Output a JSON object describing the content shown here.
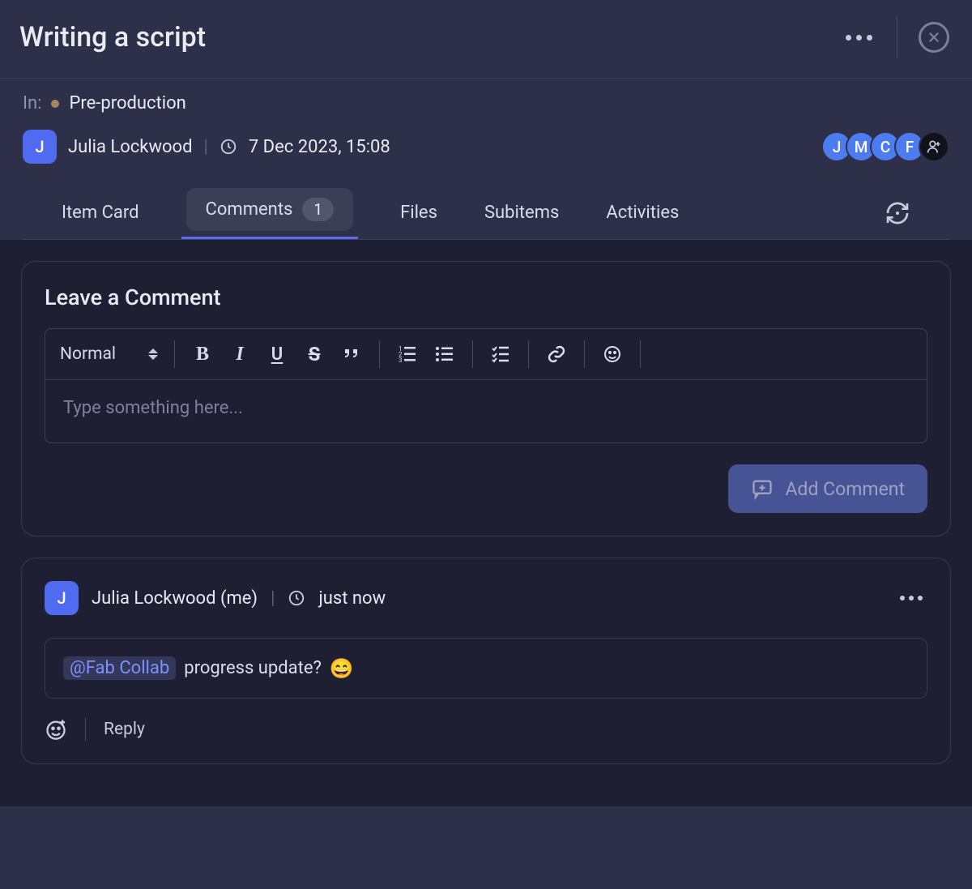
{
  "header": {
    "title": "Writing a script"
  },
  "meta": {
    "in_label": "In:",
    "in_value": "Pre-production",
    "author_initial": "J",
    "author_name": "Julia Lockwood",
    "timestamp": "7 Dec 2023, 15:08",
    "avatars": [
      "J",
      "M",
      "C",
      "F"
    ]
  },
  "tabs": {
    "item_card": "Item Card",
    "comments": "Comments",
    "comments_count": "1",
    "files": "Files",
    "subitems": "Subitems",
    "activities": "Activities"
  },
  "editor_panel": {
    "title": "Leave a Comment",
    "format_selector": "Normal",
    "placeholder": "Type something here...",
    "submit_label": "Add Comment"
  },
  "comment": {
    "author_initial": "J",
    "author_name": "Julia Lockwood (me)",
    "timestamp": "just now",
    "mention": "@Fab Collab",
    "text": "progress update?",
    "emoji": "😄",
    "reply_label": "Reply"
  }
}
